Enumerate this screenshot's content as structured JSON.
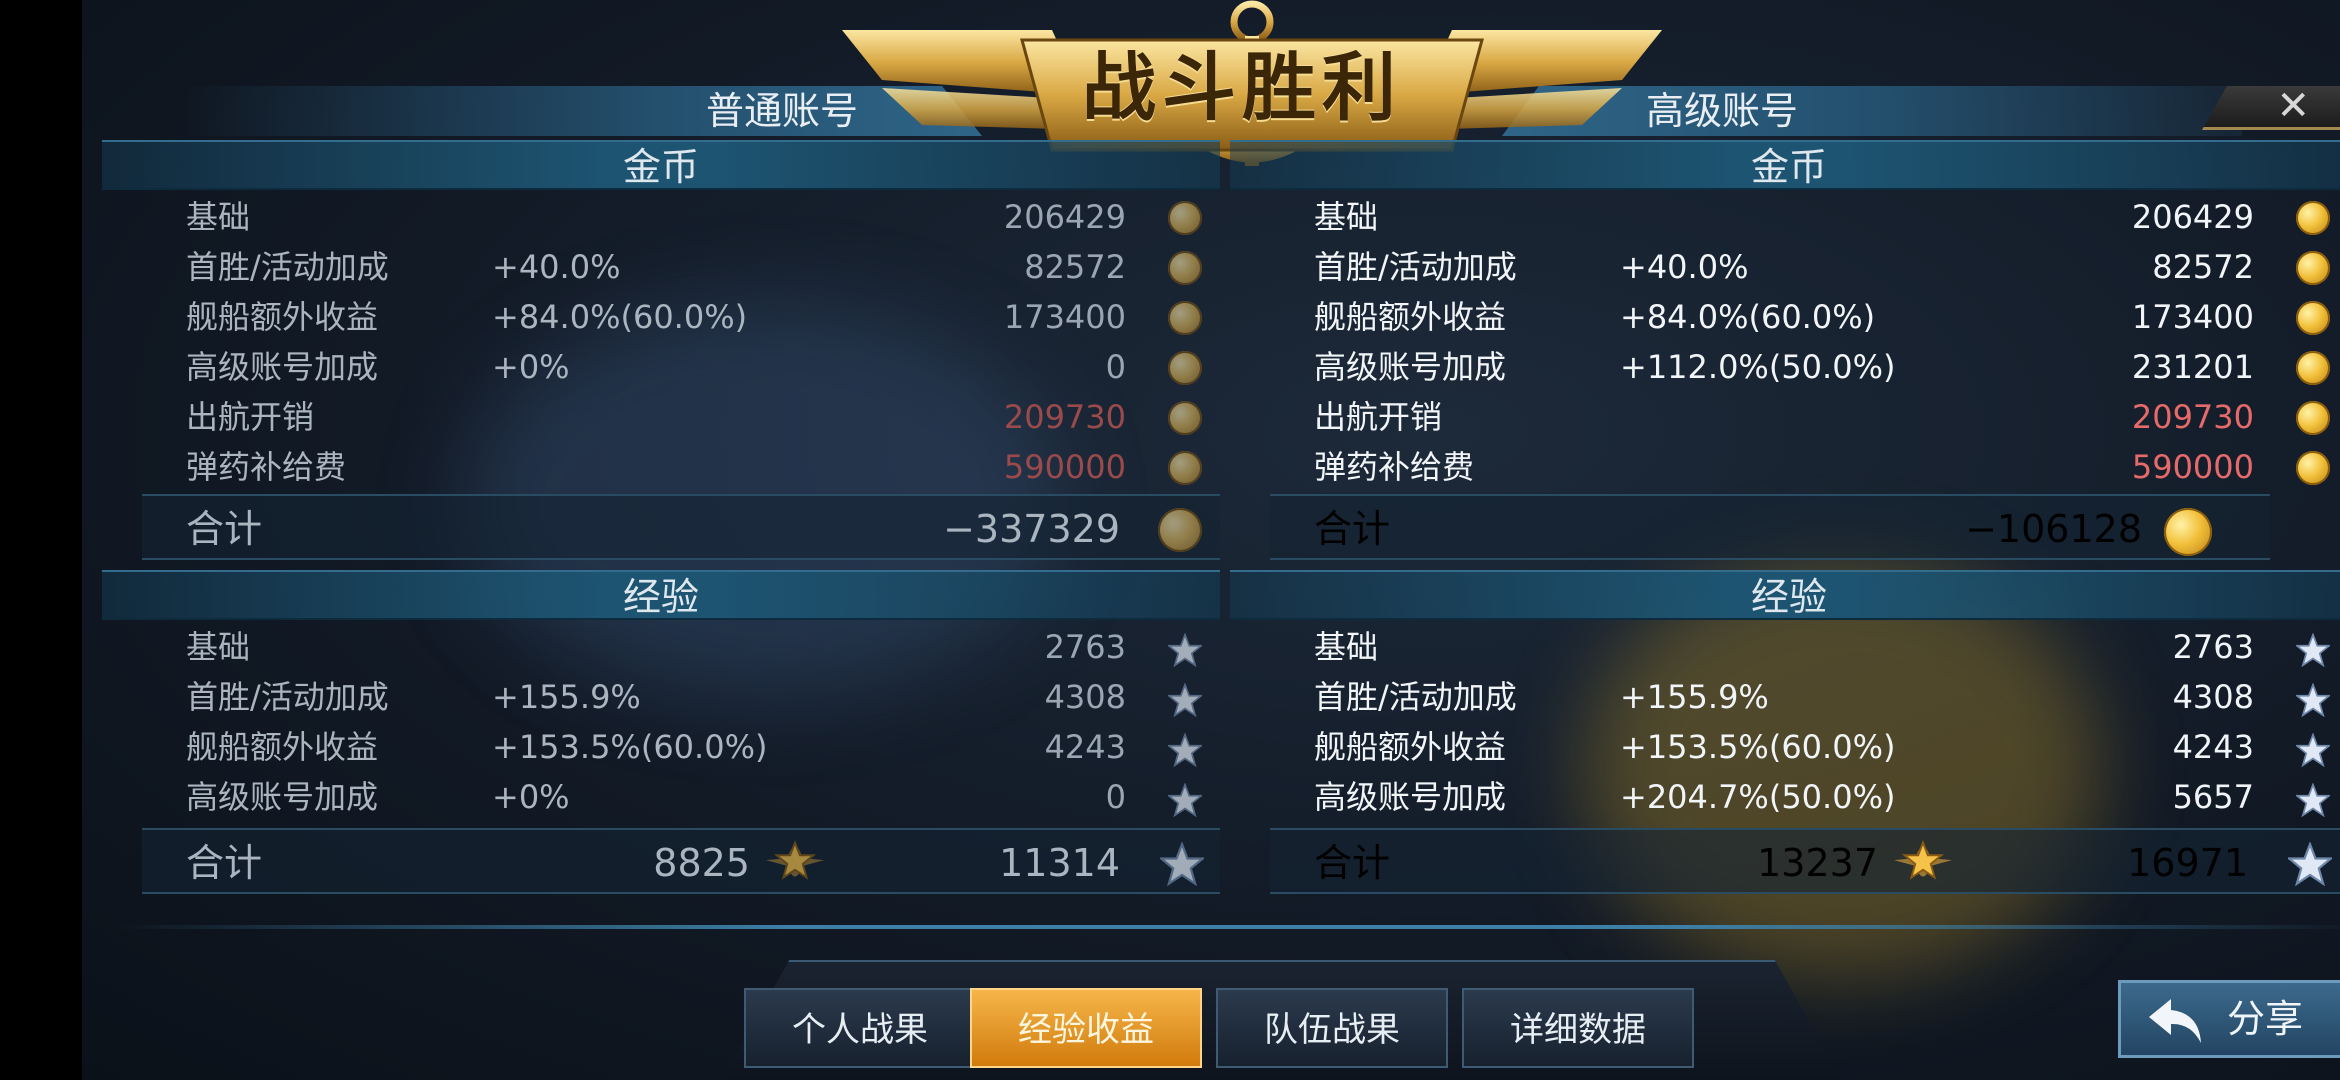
{
  "title": "战斗胜利",
  "close_symbol": "✕",
  "normal": {
    "header": "普通账号",
    "gold": {
      "title": "金币",
      "rows": [
        {
          "label": "基础",
          "pct": "",
          "value": "206429",
          "red": false
        },
        {
          "label": "首胜/活动加成",
          "pct": "+40.0%",
          "value": "82572",
          "red": false
        },
        {
          "label": "舰船额外收益",
          "pct": "+84.0%(60.0%)",
          "value": "173400",
          "red": false
        },
        {
          "label": "高级账号加成",
          "pct": "+0%",
          "value": "0",
          "red": false
        },
        {
          "label": "出航开销",
          "pct": "",
          "value": "209730",
          "red": true
        },
        {
          "label": "弹药补给费",
          "pct": "",
          "value": "590000",
          "red": true
        }
      ],
      "total_label": "合计",
      "total": "−337329"
    },
    "exp": {
      "title": "经验",
      "rows": [
        {
          "label": "基础",
          "pct": "",
          "value": "2763"
        },
        {
          "label": "首胜/活动加成",
          "pct": "+155.9%",
          "value": "4308"
        },
        {
          "label": "舰船额外收益",
          "pct": "+153.5%(60.0%)",
          "value": "4243"
        },
        {
          "label": "高级账号加成",
          "pct": "+0%",
          "value": "0"
        }
      ],
      "total_label": "合计",
      "captain_total": "8825",
      "total": "11314"
    }
  },
  "premium": {
    "header": "高级账号",
    "gold": {
      "title": "金币",
      "rows": [
        {
          "label": "基础",
          "pct": "",
          "value": "206429",
          "red": false
        },
        {
          "label": "首胜/活动加成",
          "pct": "+40.0%",
          "value": "82572",
          "red": false
        },
        {
          "label": "舰船额外收益",
          "pct": "+84.0%(60.0%)",
          "value": "173400",
          "red": false
        },
        {
          "label": "高级账号加成",
          "pct": "+112.0%(50.0%)",
          "value": "231201",
          "red": false
        },
        {
          "label": "出航开销",
          "pct": "",
          "value": "209730",
          "red": true
        },
        {
          "label": "弹药补给费",
          "pct": "",
          "value": "590000",
          "red": true
        }
      ],
      "total_label": "合计",
      "total": "−106128"
    },
    "exp": {
      "title": "经验",
      "rows": [
        {
          "label": "基础",
          "pct": "",
          "value": "2763"
        },
        {
          "label": "首胜/活动加成",
          "pct": "+155.9%",
          "value": "4308"
        },
        {
          "label": "舰船额外收益",
          "pct": "+153.5%(60.0%)",
          "value": "4243"
        },
        {
          "label": "高级账号加成",
          "pct": "+204.7%(50.0%)",
          "value": "5657"
        }
      ],
      "total_label": "合计",
      "captain_total": "13237",
      "total": "16971"
    }
  },
  "tabs": [
    {
      "label": "个人战果",
      "active": false
    },
    {
      "label": "经验收益",
      "active": true
    },
    {
      "label": "队伍战果",
      "active": false
    },
    {
      "label": "详细数据",
      "active": false
    }
  ],
  "share_label": "分享",
  "icons": {
    "gold": "gold-coin-icon",
    "exp": "star-icon",
    "captain_exp": "gold-star-icon",
    "share": "return-arrow-icon"
  },
  "colors": {
    "accent": "#f2b23a",
    "negative": "#e66a6a",
    "panel": "#1d5471"
  }
}
